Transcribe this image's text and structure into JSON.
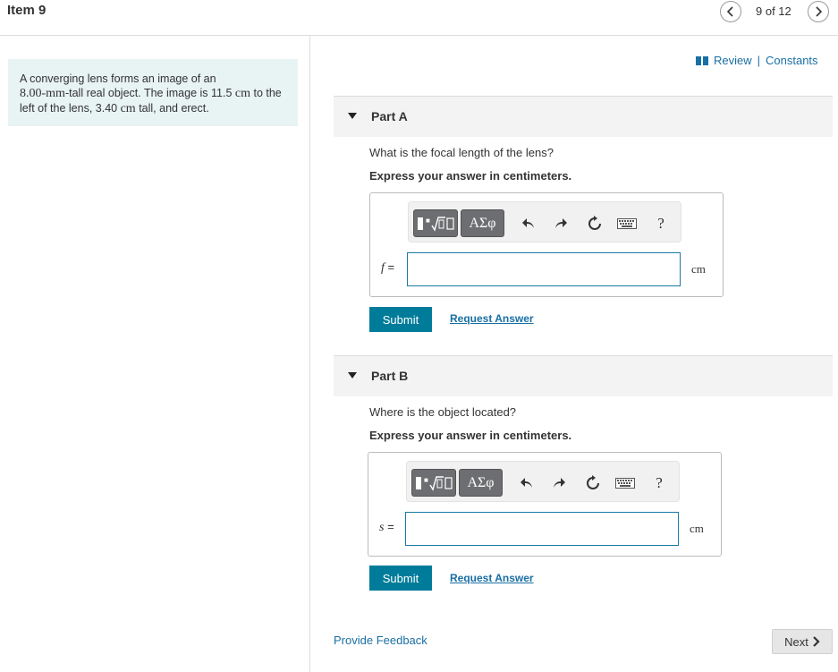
{
  "header": {
    "item_title": "Item 9",
    "item_count": "9 of 12"
  },
  "problem": {
    "text_1": "A converging lens forms an image of an",
    "value_1": "8.00-mm",
    "text_2": "-tall real object. The image is 11.5",
    "unit_2": "cm",
    "text_3": "to the left of the lens, 3.40",
    "unit_3": "cm",
    "text_4": "tall, and erect."
  },
  "links": {
    "review": "Review",
    "separator": "|",
    "constants": "Constants",
    "provide_feedback": "Provide Feedback",
    "next": "Next"
  },
  "parts": [
    {
      "label": "Part A",
      "question": "What is the focal length of the lens?",
      "instruction": "Express your answer in centimeters.",
      "variable": "f",
      "equals": "=",
      "unit": "cm",
      "input_value": "",
      "submit_label": "Submit",
      "request_label": "Request Answer"
    },
    {
      "label": "Part B",
      "question": "Where is the object located?",
      "instruction": "Express your answer in centimeters.",
      "variable": "s",
      "equals": "=",
      "unit": "cm",
      "input_value": "",
      "submit_label": "Submit",
      "request_label": "Request Answer"
    }
  ],
  "toolbar": {
    "greek_label": "ΑΣφ",
    "help_label": "?",
    "icons": [
      "math-template-icon",
      "greek-letters-icon",
      "undo-icon",
      "redo-icon",
      "reset-icon",
      "keyboard-icon",
      "help-icon"
    ]
  },
  "colors": {
    "accent": "#007c9a",
    "link": "#1a6fa3",
    "problem_bg": "#e8f3f4"
  }
}
